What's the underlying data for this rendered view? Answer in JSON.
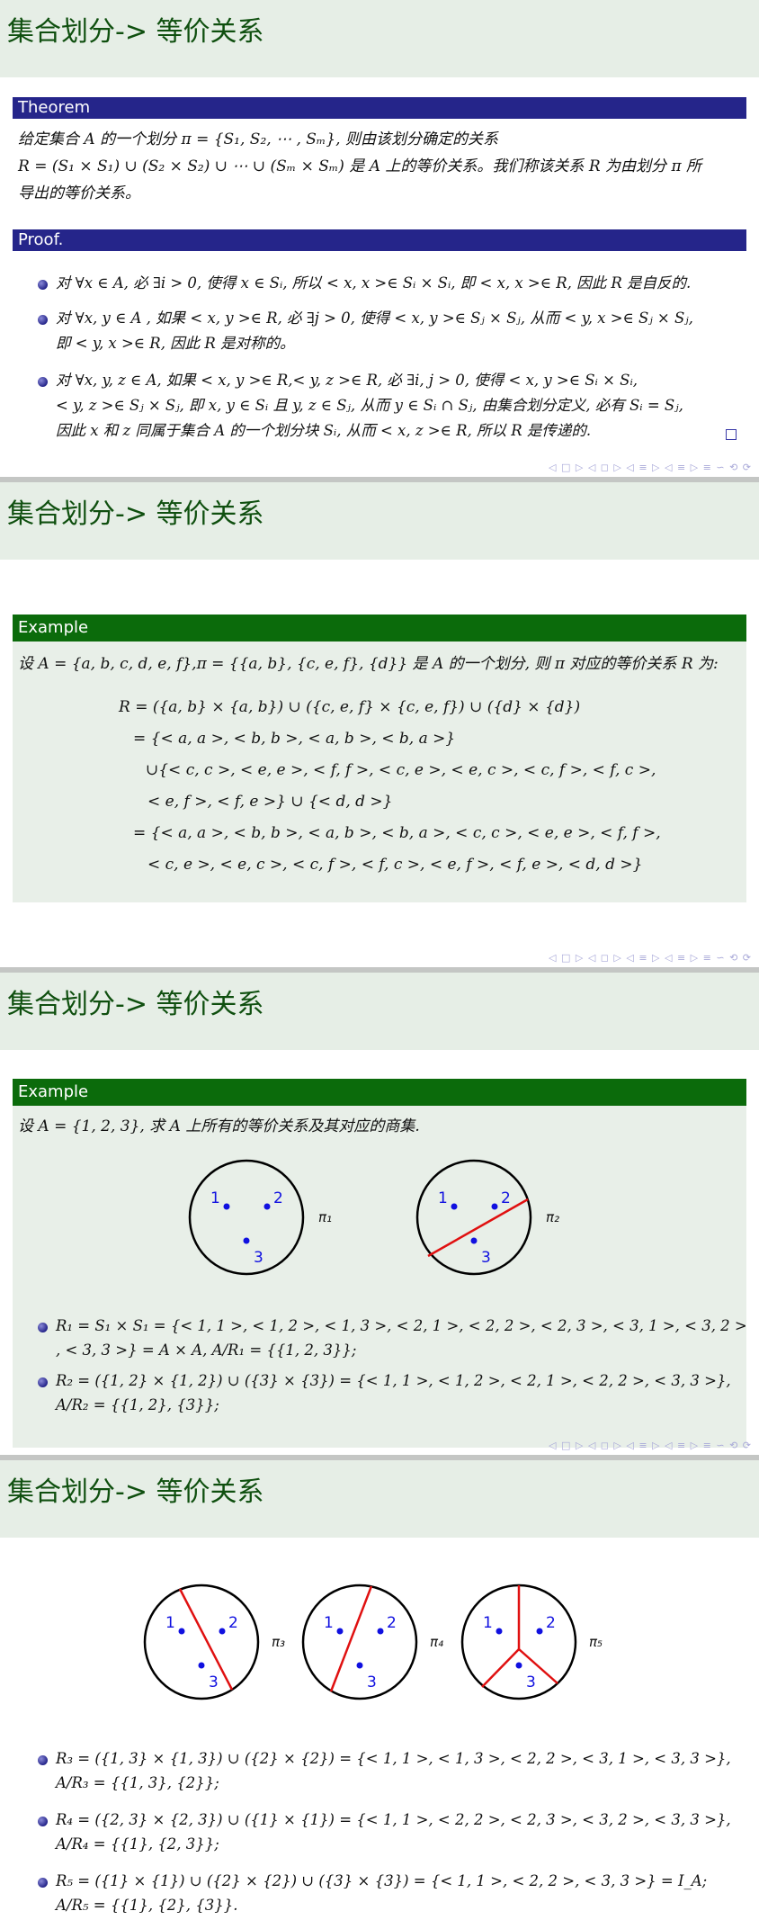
{
  "colors": {
    "title": "#0f4f0f",
    "title_bg": "#e6eee6",
    "theorem_bar": "#25258a",
    "example_bar": "#0b6b0b",
    "block_bg": "#e8efe8",
    "point": "#1010e0",
    "line": "#e01010"
  },
  "frame_title": "集合划分-> 等价关系",
  "nav_symbols": "◁ □ ▷ ◁ ◻ ▷ ◁ ≡ ▷ ◁ ≡ ▷   ≡   ∽ ⟲ ⟳",
  "slide1": {
    "theorem_label": "Theorem",
    "theorem_lines": [
      "给定集合 A 的一个划分 π = {S₁, S₂, ⋯ , Sₘ}, 则由该划分确定的关系",
      "R = (S₁ × S₁) ∪ (S₂ × S₂) ∪ ⋯ ∪ (Sₘ × Sₘ) 是 A 上的等价关系。我们称该关系 R 为由划分 π 所",
      "导出的等价关系。"
    ],
    "proof_label": "Proof.",
    "proof_items": [
      [
        "对 ∀x ∈ A, 必 ∃i > 0, 使得 x ∈ Sᵢ, 所以 < x, x >∈ Sᵢ × Sᵢ, 即 < x, x >∈ R, 因此 R 是自反的."
      ],
      [
        "对 ∀x, y ∈ A , 如果 < x, y >∈ R, 必 ∃j > 0, 使得 < x, y >∈ Sⱼ × Sⱼ, 从而 < y, x >∈ Sⱼ × Sⱼ,",
        "即 < y, x >∈ R, 因此 R 是对称的。"
      ],
      [
        "对 ∀x, y, z ∈ A, 如果 < x, y >∈ R,< y, z >∈ R, 必 ∃i, j > 0, 使得 < x, y >∈ Sᵢ × Sᵢ,",
        "< y, z >∈ Sⱼ × Sⱼ, 即 x, y ∈ Sᵢ 且 y, z ∈ Sⱼ, 从而 y ∈ Sᵢ ∩ Sⱼ, 由集合划分定义, 必有 Sᵢ = Sⱼ,",
        "因此 x 和 z 同属于集合 A 的一个划分块 Sᵢ, 从而 < x, z >∈ R, 所以 R 是传递的."
      ]
    ]
  },
  "slide2": {
    "example_label": "Example",
    "intro": "设 A = {a, b, c, d, e, f},π = {{a, b}, {c, e, f}, {d}} 是 A 的一个划分, 则 π 对应的等价关系 R 为:",
    "equation_lines": [
      "R = ({a, b} × {a, b}) ∪ ({c, e, f} × {c, e, f}) ∪ ({d} × {d})",
      "= {< a, a >, < b, b >, < a, b >, < b, a >}",
      "∪{< c, c >, < e, e >, < f, f >, < c, e >, < e, c >, < c, f >, < f, c >,",
      "< e, f >, < f, e >} ∪ {< d, d >}",
      "= {< a, a >, < b, b >, < a, b >, < b, a >, < c, c >, < e, e >, < f, f >,",
      "< c, e >, < e, c >, < c, f >, < f, c >, < e, f >, < f, e >, < d, d >}"
    ]
  },
  "slide3": {
    "example_label": "Example",
    "intro": "设 A = {1, 2, 3}, 求 A 上所有的等价关系及其对应的商集.",
    "diagrams": [
      {
        "label": "π₁",
        "points": [
          "1",
          "2",
          "3"
        ]
      },
      {
        "label": "π₂",
        "points": [
          "1",
          "2",
          "3"
        ]
      }
    ],
    "items": [
      [
        "R₁ = S₁ × S₁ = {< 1, 1 >, < 1, 2 >, < 1, 3 >, < 2, 1 >, < 2, 2 >, < 2, 3 >, < 3, 1 >, < 3, 2 >",
        ", < 3, 3 >} = A × A, A/R₁ = {{1, 2, 3}};"
      ],
      [
        "R₂ = ({1, 2} × {1, 2}) ∪ ({3} × {3}) = {< 1, 1 >, < 1, 2 >, < 2, 1 >, < 2, 2 >, < 3, 3 >},",
        "A/R₂ = {{1, 2}, {3}};"
      ]
    ]
  },
  "slide4": {
    "diagrams": [
      {
        "label": "π₃",
        "points": [
          "1",
          "2",
          "3"
        ]
      },
      {
        "label": "π₄",
        "points": [
          "1",
          "2",
          "3"
        ]
      },
      {
        "label": "π₅",
        "points": [
          "1",
          "2",
          "3"
        ]
      }
    ],
    "items": [
      [
        "R₃ = ({1, 3} × {1, 3}) ∪ ({2} × {2}) = {< 1, 1 >, < 1, 3 >, < 2, 2 >, < 3, 1 >, < 3, 3 >},",
        "A/R₃ = {{1, 3}, {2}};"
      ],
      [
        "R₄ = ({2, 3} × {2, 3}) ∪ ({1} × {1}) = {< 1, 1 >, < 2, 2 >, < 2, 3 >, < 3, 2 >, < 3, 3 >},",
        "A/R₄ = {{1}, {2, 3}};"
      ],
      [
        "R₅ = ({1} × {1}) ∪ ({2} × {2}) ∪ ({3} × {3}) = {< 1, 1 >, < 2, 2 >, < 3, 3 >} = I_A;",
        "A/R₅ = {{1}, {2}, {3}}."
      ]
    ]
  }
}
